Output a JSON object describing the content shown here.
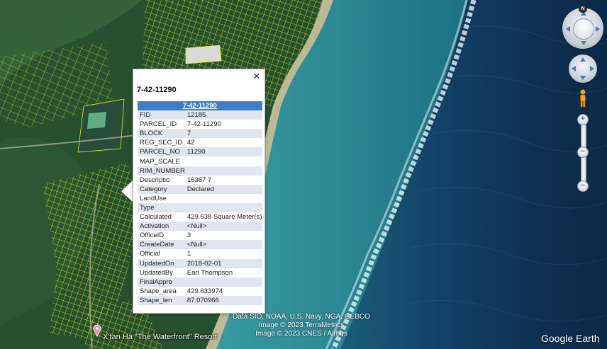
{
  "popup": {
    "title": "7-42-11290",
    "header": "7-42-11290",
    "close_glyph": "×",
    "rows": [
      {
        "key": "FID",
        "value": "12185"
      },
      {
        "key": "PARCEL_ID",
        "value": "7-42-11290"
      },
      {
        "key": "BLOCK",
        "value": "7"
      },
      {
        "key": "REG_SEC_ID",
        "value": "42"
      },
      {
        "key": "PARCEL_NO",
        "value": "11290"
      },
      {
        "key": "MAP_SCALE",
        "value": ""
      },
      {
        "key": "RIM_NUMBER",
        "value": ""
      },
      {
        "key": "Descriptio",
        "value": "16367 7"
      },
      {
        "key": "Category",
        "value": "Declared"
      },
      {
        "key": "LandUse",
        "value": ""
      },
      {
        "key": "Type",
        "value": ""
      },
      {
        "key": "Calculated",
        "value": "429.638 Square Meter(s)"
      },
      {
        "key": "Activation",
        "value": "<Null>"
      },
      {
        "key": "OfficeID",
        "value": "3"
      },
      {
        "key": "CreateDate",
        "value": "<Null>"
      },
      {
        "key": "Official",
        "value": "1"
      },
      {
        "key": "UpdatedOn",
        "value": "2018-02-01"
      },
      {
        "key": "UpdatedBy",
        "value": "Earl Thompson"
      },
      {
        "key": "FinalAppro",
        "value": ""
      },
      {
        "key": "Shape_area",
        "value": "429.633974"
      },
      {
        "key": "Shape_len",
        "value": "87.070966"
      }
    ]
  },
  "map": {
    "place_label": "X'tan Ha \"The Waterfront\" Resort",
    "attribution": [
      "Data SIO, NOAA, U.S. Navy, NGA, GEBCO",
      "Image © 2023 TerraMetrics",
      "Image © 2023 CNES / Airbus"
    ],
    "brand": "Google Earth",
    "north_label": "N",
    "zoom_in": "+",
    "zoom_out": "−",
    "colors": {
      "parcel_lines": "#e8f000",
      "ocean_deep": "#0d2a4a",
      "lagoon": "#2f8f9a",
      "land": "#1f4a2b",
      "popup_header": "#3f7fc9"
    }
  }
}
